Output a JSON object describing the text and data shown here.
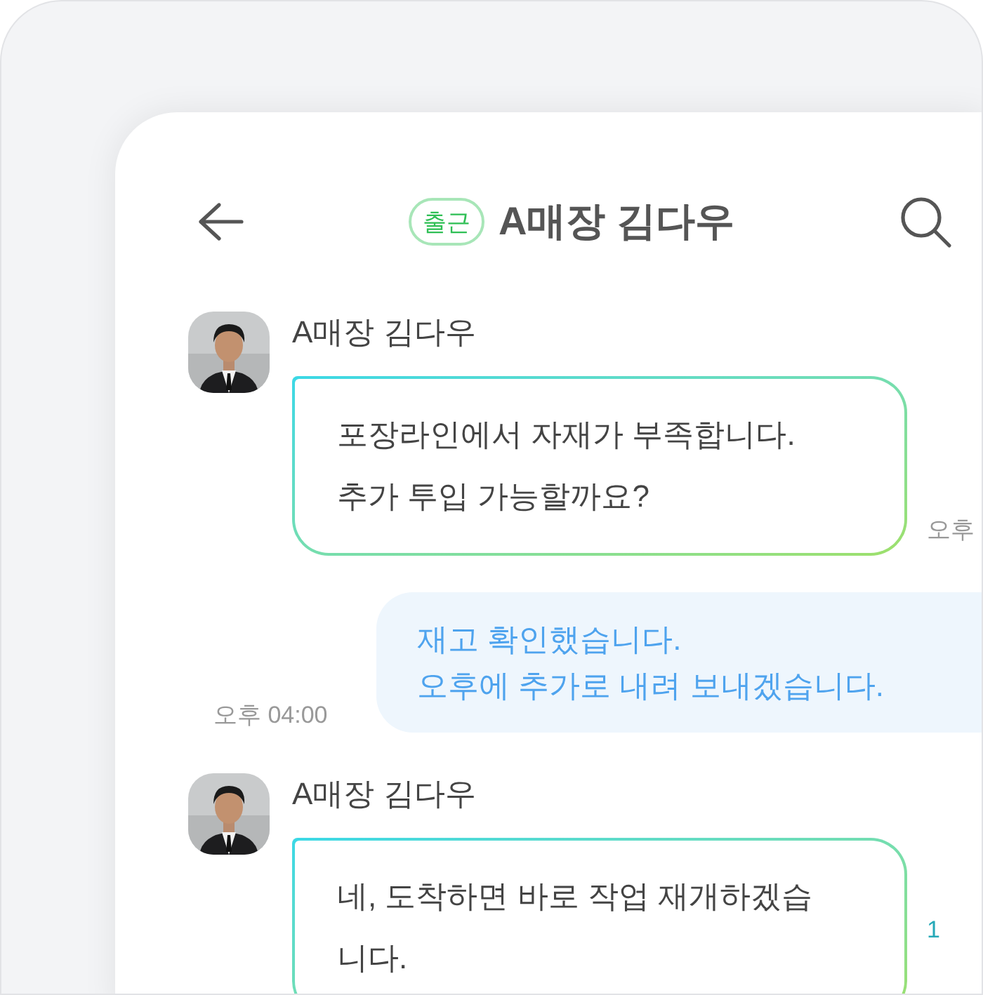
{
  "header": {
    "status_badge": "출근",
    "title": "A매장 김다우"
  },
  "messages": [
    {
      "kind": "received",
      "sender": "A매장 김다우",
      "text": "포장라인에서 자재가 부족합니다.\n추가 투입 가능할까요?",
      "time": "오후"
    },
    {
      "kind": "sent",
      "text": "재고 확인했습니다.\n오후에 추가로 내려 보내겠습니다.",
      "time": "오후 04:00"
    },
    {
      "kind": "received",
      "sender": "A매장 김다우",
      "text": "네, 도착하면 바로 작업 재개하겠습니다.",
      "unread_count": "1"
    }
  ]
}
